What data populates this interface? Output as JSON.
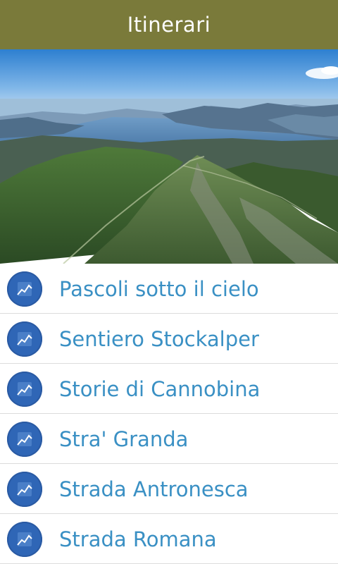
{
  "header": {
    "title": "Itinerari"
  },
  "hero": {
    "image": "mountain-lake-landscape"
  },
  "itinerari": [
    {
      "label": "Pascoli sotto il cielo",
      "icon": "trail-profile-icon"
    },
    {
      "label": "Sentiero Stockalper",
      "icon": "trail-profile-icon"
    },
    {
      "label": "Storie di Cannobina",
      "icon": "trail-profile-icon"
    },
    {
      "label": "Stra' Granda",
      "icon": "trail-profile-icon"
    },
    {
      "label": "Strada Antronesca",
      "icon": "trail-profile-icon"
    },
    {
      "label": "Strada Romana",
      "icon": "trail-profile-icon"
    }
  ],
  "colors": {
    "header": "#7a7a3a",
    "badge": "#2f66b6",
    "item_text": "#3a90c4"
  }
}
